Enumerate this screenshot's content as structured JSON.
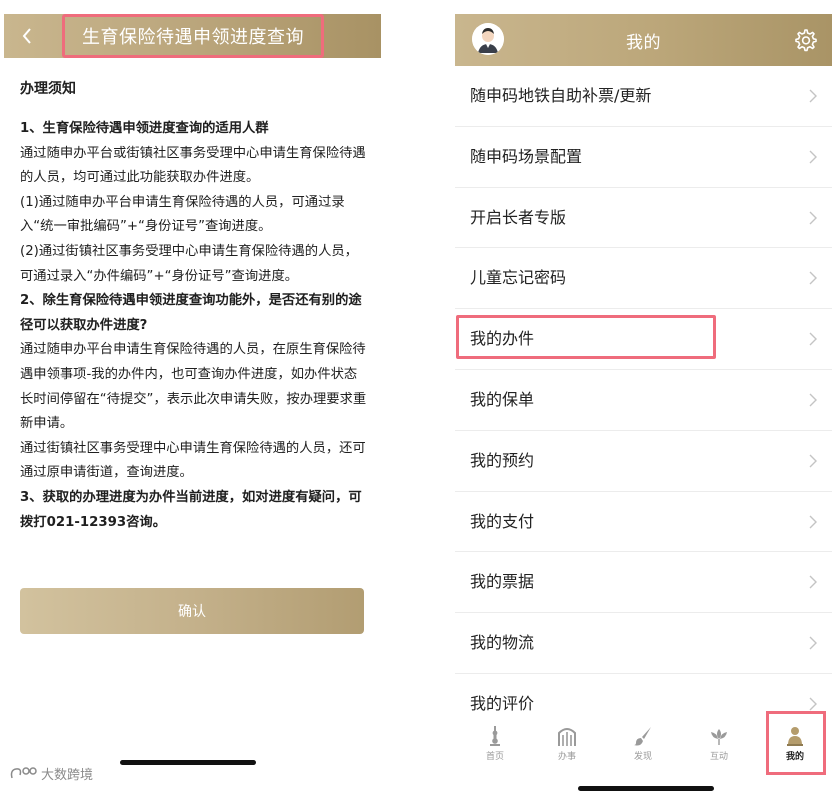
{
  "left": {
    "header": {
      "title": "生育保险待遇申领进度查询",
      "back_icon": "chevron-left-icon"
    },
    "notice": {
      "title": "办理须知",
      "paragraphs": [
        {
          "text": "1、生育保险待遇申领进度查询的适用人群",
          "bold": true
        },
        {
          "text": "通过随申办平台或街镇社区事务受理中心申请生育保险待遇的人员，均可通过此功能获取办件进度。",
          "bold": false
        },
        {
          "text": "(1)通过随申办平台申请生育保险待遇的人员，可通过录入“统一审批编码”+“身份证号”查询进度。",
          "bold": false
        },
        {
          "text": "(2)通过街镇社区事务受理中心申请生育保险待遇的人员，可通过录入“办件编码”+“身份证号”查询进度。",
          "bold": false
        },
        {
          "text": "2、除生育保险待遇申领进度查询功能外，是否还有别的途径可以获取办件进度?",
          "bold": true
        },
        {
          "text": "通过随申办平台申请生育保险待遇的人员，在原生育保险待遇申领事项-我的办件内，也可查询办件进度，如办件状态长时间停留在“待提交”，表示此次申请失败，按办理要求重新申请。",
          "bold": false
        },
        {
          "text": "通过街镇社区事务受理中心申请生育保险待遇的人员，还可通过原申请街道，查询进度。",
          "bold": false
        },
        {
          "text": "3、获取的办理进度为办件当前进度，如对进度有疑问，可拨打021-12393咨询。",
          "bold": true
        }
      ]
    },
    "confirm_label": "确认",
    "watermark": "大数跨境"
  },
  "right": {
    "header": {
      "title": "我的",
      "avatar_icon": "avatar",
      "settings_icon": "gear-icon"
    },
    "menu": [
      {
        "label": "随申码地铁自助补票/更新"
      },
      {
        "label": "随申码场景配置"
      },
      {
        "label": "开启长者专版"
      },
      {
        "label": "儿童忘记密码"
      },
      {
        "label": "我的办件"
      },
      {
        "label": "我的保单"
      },
      {
        "label": "我的预约"
      },
      {
        "label": "我的支付"
      },
      {
        "label": "我的票据"
      },
      {
        "label": "我的物流"
      },
      {
        "label": "我的评价"
      }
    ],
    "tabs": [
      {
        "label": "首页",
        "icon": "tower-icon"
      },
      {
        "label": "办事",
        "icon": "gate-icon"
      },
      {
        "label": "发现",
        "icon": "brush-icon"
      },
      {
        "label": "互动",
        "icon": "flower-icon"
      },
      {
        "label": "我的",
        "icon": "person-icon",
        "active": true
      }
    ]
  },
  "colors": {
    "accent": "#bba679",
    "highlight": "#ef6c7c"
  }
}
